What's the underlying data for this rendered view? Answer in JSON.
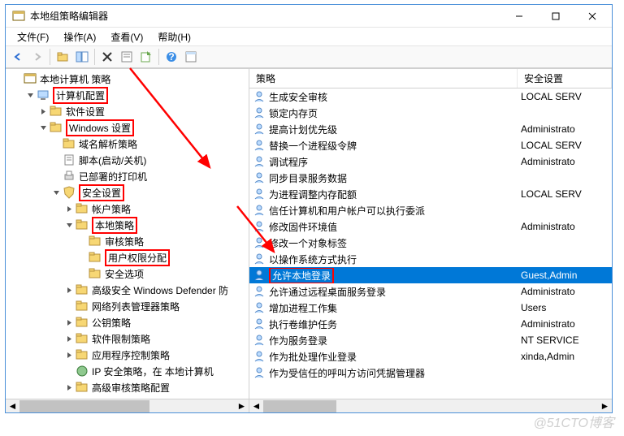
{
  "title": "本地组策略编辑器",
  "menus": {
    "file": "文件(F)",
    "action": "操作(A)",
    "view": "查看(V)",
    "help": "帮助(H)"
  },
  "columns": {
    "policy": "策略",
    "security": "安全设置"
  },
  "tree": [
    {
      "label": "本地计算机 策略",
      "depth": 0,
      "expand": "none",
      "icon": "root",
      "red": false
    },
    {
      "label": "计算机配置",
      "depth": 1,
      "expand": "open",
      "icon": "computer",
      "red": true
    },
    {
      "label": "软件设置",
      "depth": 2,
      "expand": "closed",
      "icon": "folder",
      "red": false
    },
    {
      "label": "Windows 设置",
      "depth": 2,
      "expand": "open",
      "icon": "folder",
      "red": true
    },
    {
      "label": "域名解析策略",
      "depth": 3,
      "expand": "none",
      "icon": "folder",
      "red": false
    },
    {
      "label": "脚本(启动/关机)",
      "depth": 3,
      "expand": "none",
      "icon": "script",
      "red": false
    },
    {
      "label": "已部署的打印机",
      "depth": 3,
      "expand": "none",
      "icon": "printer",
      "red": false
    },
    {
      "label": "安全设置",
      "depth": 3,
      "expand": "open",
      "icon": "shield",
      "red": true
    },
    {
      "label": "帐户策略",
      "depth": 4,
      "expand": "closed",
      "icon": "folder",
      "red": false
    },
    {
      "label": "本地策略",
      "depth": 4,
      "expand": "open",
      "icon": "folder",
      "red": true
    },
    {
      "label": "审核策略",
      "depth": 5,
      "expand": "none",
      "icon": "folder",
      "red": false
    },
    {
      "label": "用户权限分配",
      "depth": 5,
      "expand": "none",
      "icon": "folder",
      "red": true
    },
    {
      "label": "安全选项",
      "depth": 5,
      "expand": "none",
      "icon": "folder",
      "red": false
    },
    {
      "label": "高级安全 Windows Defender 防",
      "depth": 4,
      "expand": "closed",
      "icon": "folder",
      "red": false
    },
    {
      "label": "网络列表管理器策略",
      "depth": 4,
      "expand": "none",
      "icon": "folder",
      "red": false
    },
    {
      "label": "公钥策略",
      "depth": 4,
      "expand": "closed",
      "icon": "folder",
      "red": false
    },
    {
      "label": "软件限制策略",
      "depth": 4,
      "expand": "closed",
      "icon": "folder",
      "red": false
    },
    {
      "label": "应用程序控制策略",
      "depth": 4,
      "expand": "closed",
      "icon": "folder",
      "red": false
    },
    {
      "label": "IP 安全策略，在 本地计算机",
      "depth": 4,
      "expand": "none",
      "icon": "ip",
      "red": false
    },
    {
      "label": "高级审核策略配置",
      "depth": 4,
      "expand": "closed",
      "icon": "folder",
      "red": false
    }
  ],
  "policies": [
    {
      "name": "生成安全审核",
      "setting": "LOCAL SERV"
    },
    {
      "name": "锁定内存页",
      "setting": ""
    },
    {
      "name": "提高计划优先级",
      "setting": "Administrato"
    },
    {
      "name": "替换一个进程级令牌",
      "setting": "LOCAL SERV"
    },
    {
      "name": "调试程序",
      "setting": "Administrato"
    },
    {
      "name": "同步目录服务数据",
      "setting": ""
    },
    {
      "name": "为进程调整内存配额",
      "setting": "LOCAL SERV"
    },
    {
      "name": "信任计算机和用户帐户可以执行委派",
      "setting": ""
    },
    {
      "name": "修改固件环境值",
      "setting": "Administrato"
    },
    {
      "name": "修改一个对象标签",
      "setting": ""
    },
    {
      "name": "以操作系统方式执行",
      "setting": ""
    },
    {
      "name": "允许本地登录",
      "setting": "Guest,Admin",
      "selected": true,
      "red": true
    },
    {
      "name": "允许通过远程桌面服务登录",
      "setting": "Administrato"
    },
    {
      "name": "增加进程工作集",
      "setting": "Users"
    },
    {
      "name": "执行卷维护任务",
      "setting": "Administrato"
    },
    {
      "name": "作为服务登录",
      "setting": "NT SERVICE"
    },
    {
      "name": "作为批处理作业登录",
      "setting": "xinda,Admin"
    },
    {
      "name": "作为受信任的呼叫方访问凭据管理器",
      "setting": ""
    }
  ],
  "watermark": "@51CTO博客",
  "col_widths": {
    "c1": 330,
    "c2": 90
  }
}
